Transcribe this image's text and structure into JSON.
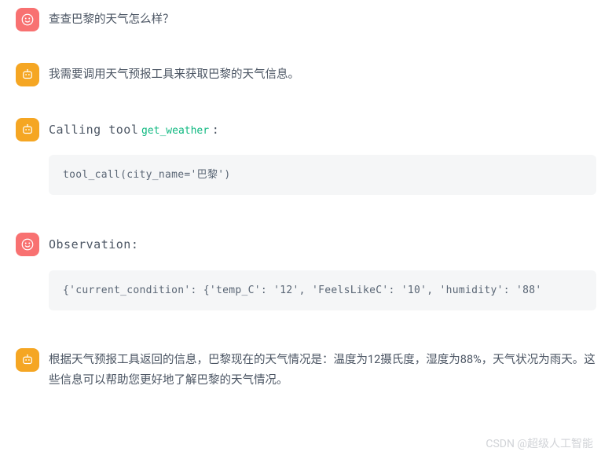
{
  "messages": {
    "user_query": "查查巴黎的天气怎么样？",
    "assistant_thought": "我需要调用天气预报工具来获取巴黎的天气信息。",
    "calling_tool_prefix": "Calling tool",
    "calling_tool_name": "get_weather",
    "calling_tool_suffix": ":",
    "tool_call_code": "tool_call(city_name='巴黎')",
    "observation_label": "Observation:",
    "observation_content": "{'current_condition': {'temp_C': '12', 'FeelsLikeC': '10', 'humidity': '88'",
    "final_answer": "根据天气预报工具返回的信息，巴黎现在的天气情况是：温度为12摄氏度，湿度为88%，天气状况为雨天。这些信息可以帮助您更好地了解巴黎的天气情况。"
  },
  "watermark": "CSDN @超级人工智能",
  "colors": {
    "red_avatar": "#f87171",
    "orange_avatar": "#f5a623",
    "tool_name_green": "#10b981",
    "code_bg": "#f5f6f7"
  }
}
